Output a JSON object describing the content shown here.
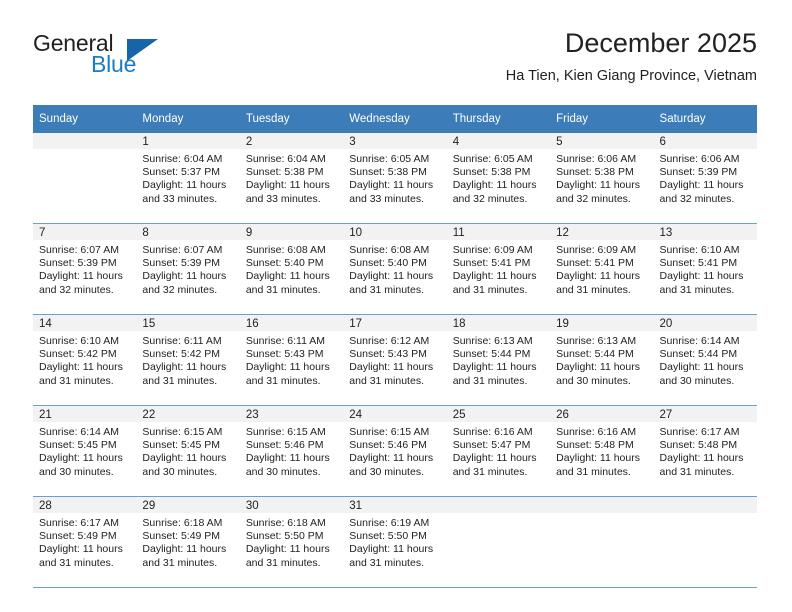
{
  "brand": {
    "name_part1": "General",
    "name_part2": "Blue",
    "triangle_icon": "triangle-icon",
    "accent_blue": "#1d7cc1",
    "logo_dark": "#231f20"
  },
  "header": {
    "month_title": "December 2025",
    "location": "Ha Tien, Kien Giang Province, Vietnam"
  },
  "theme": {
    "header_bg": "#3c7cb9",
    "header_text": "#ffffff",
    "daynum_bg": "#f2f2f2",
    "row_divider": "#6e9ed1",
    "body_text": "#222222"
  },
  "calendar": {
    "weekdays": [
      "Sunday",
      "Monday",
      "Tuesday",
      "Wednesday",
      "Thursday",
      "Friday",
      "Saturday"
    ],
    "labels": {
      "sunrise": "Sunrise:",
      "sunset": "Sunset:",
      "daylight": "Daylight:"
    },
    "weeks": [
      [
        {
          "day": "",
          "sunrise": "",
          "sunset": "",
          "daylight": ""
        },
        {
          "day": "1",
          "sunrise": "Sunrise: 6:04 AM",
          "sunset": "Sunset: 5:37 PM",
          "daylight": "Daylight: 11 hours and 33 minutes."
        },
        {
          "day": "2",
          "sunrise": "Sunrise: 6:04 AM",
          "sunset": "Sunset: 5:38 PM",
          "daylight": "Daylight: 11 hours and 33 minutes."
        },
        {
          "day": "3",
          "sunrise": "Sunrise: 6:05 AM",
          "sunset": "Sunset: 5:38 PM",
          "daylight": "Daylight: 11 hours and 33 minutes."
        },
        {
          "day": "4",
          "sunrise": "Sunrise: 6:05 AM",
          "sunset": "Sunset: 5:38 PM",
          "daylight": "Daylight: 11 hours and 32 minutes."
        },
        {
          "day": "5",
          "sunrise": "Sunrise: 6:06 AM",
          "sunset": "Sunset: 5:38 PM",
          "daylight": "Daylight: 11 hours and 32 minutes."
        },
        {
          "day": "6",
          "sunrise": "Sunrise: 6:06 AM",
          "sunset": "Sunset: 5:39 PM",
          "daylight": "Daylight: 11 hours and 32 minutes."
        }
      ],
      [
        {
          "day": "7",
          "sunrise": "Sunrise: 6:07 AM",
          "sunset": "Sunset: 5:39 PM",
          "daylight": "Daylight: 11 hours and 32 minutes."
        },
        {
          "day": "8",
          "sunrise": "Sunrise: 6:07 AM",
          "sunset": "Sunset: 5:39 PM",
          "daylight": "Daylight: 11 hours and 32 minutes."
        },
        {
          "day": "9",
          "sunrise": "Sunrise: 6:08 AM",
          "sunset": "Sunset: 5:40 PM",
          "daylight": "Daylight: 11 hours and 31 minutes."
        },
        {
          "day": "10",
          "sunrise": "Sunrise: 6:08 AM",
          "sunset": "Sunset: 5:40 PM",
          "daylight": "Daylight: 11 hours and 31 minutes."
        },
        {
          "day": "11",
          "sunrise": "Sunrise: 6:09 AM",
          "sunset": "Sunset: 5:41 PM",
          "daylight": "Daylight: 11 hours and 31 minutes."
        },
        {
          "day": "12",
          "sunrise": "Sunrise: 6:09 AM",
          "sunset": "Sunset: 5:41 PM",
          "daylight": "Daylight: 11 hours and 31 minutes."
        },
        {
          "day": "13",
          "sunrise": "Sunrise: 6:10 AM",
          "sunset": "Sunset: 5:41 PM",
          "daylight": "Daylight: 11 hours and 31 minutes."
        }
      ],
      [
        {
          "day": "14",
          "sunrise": "Sunrise: 6:10 AM",
          "sunset": "Sunset: 5:42 PM",
          "daylight": "Daylight: 11 hours and 31 minutes."
        },
        {
          "day": "15",
          "sunrise": "Sunrise: 6:11 AM",
          "sunset": "Sunset: 5:42 PM",
          "daylight": "Daylight: 11 hours and 31 minutes."
        },
        {
          "day": "16",
          "sunrise": "Sunrise: 6:11 AM",
          "sunset": "Sunset: 5:43 PM",
          "daylight": "Daylight: 11 hours and 31 minutes."
        },
        {
          "day": "17",
          "sunrise": "Sunrise: 6:12 AM",
          "sunset": "Sunset: 5:43 PM",
          "daylight": "Daylight: 11 hours and 31 minutes."
        },
        {
          "day": "18",
          "sunrise": "Sunrise: 6:13 AM",
          "sunset": "Sunset: 5:44 PM",
          "daylight": "Daylight: 11 hours and 31 minutes."
        },
        {
          "day": "19",
          "sunrise": "Sunrise: 6:13 AM",
          "sunset": "Sunset: 5:44 PM",
          "daylight": "Daylight: 11 hours and 30 minutes."
        },
        {
          "day": "20",
          "sunrise": "Sunrise: 6:14 AM",
          "sunset": "Sunset: 5:44 PM",
          "daylight": "Daylight: 11 hours and 30 minutes."
        }
      ],
      [
        {
          "day": "21",
          "sunrise": "Sunrise: 6:14 AM",
          "sunset": "Sunset: 5:45 PM",
          "daylight": "Daylight: 11 hours and 30 minutes."
        },
        {
          "day": "22",
          "sunrise": "Sunrise: 6:15 AM",
          "sunset": "Sunset: 5:45 PM",
          "daylight": "Daylight: 11 hours and 30 minutes."
        },
        {
          "day": "23",
          "sunrise": "Sunrise: 6:15 AM",
          "sunset": "Sunset: 5:46 PM",
          "daylight": "Daylight: 11 hours and 30 minutes."
        },
        {
          "day": "24",
          "sunrise": "Sunrise: 6:15 AM",
          "sunset": "Sunset: 5:46 PM",
          "daylight": "Daylight: 11 hours and 30 minutes."
        },
        {
          "day": "25",
          "sunrise": "Sunrise: 6:16 AM",
          "sunset": "Sunset: 5:47 PM",
          "daylight": "Daylight: 11 hours and 31 minutes."
        },
        {
          "day": "26",
          "sunrise": "Sunrise: 6:16 AM",
          "sunset": "Sunset: 5:48 PM",
          "daylight": "Daylight: 11 hours and 31 minutes."
        },
        {
          "day": "27",
          "sunrise": "Sunrise: 6:17 AM",
          "sunset": "Sunset: 5:48 PM",
          "daylight": "Daylight: 11 hours and 31 minutes."
        }
      ],
      [
        {
          "day": "28",
          "sunrise": "Sunrise: 6:17 AM",
          "sunset": "Sunset: 5:49 PM",
          "daylight": "Daylight: 11 hours and 31 minutes."
        },
        {
          "day": "29",
          "sunrise": "Sunrise: 6:18 AM",
          "sunset": "Sunset: 5:49 PM",
          "daylight": "Daylight: 11 hours and 31 minutes."
        },
        {
          "day": "30",
          "sunrise": "Sunrise: 6:18 AM",
          "sunset": "Sunset: 5:50 PM",
          "daylight": "Daylight: 11 hours and 31 minutes."
        },
        {
          "day": "31",
          "sunrise": "Sunrise: 6:19 AM",
          "sunset": "Sunset: 5:50 PM",
          "daylight": "Daylight: 11 hours and 31 minutes."
        },
        {
          "day": "",
          "sunrise": "",
          "sunset": "",
          "daylight": ""
        },
        {
          "day": "",
          "sunrise": "",
          "sunset": "",
          "daylight": ""
        },
        {
          "day": "",
          "sunrise": "",
          "sunset": "",
          "daylight": ""
        }
      ]
    ]
  }
}
